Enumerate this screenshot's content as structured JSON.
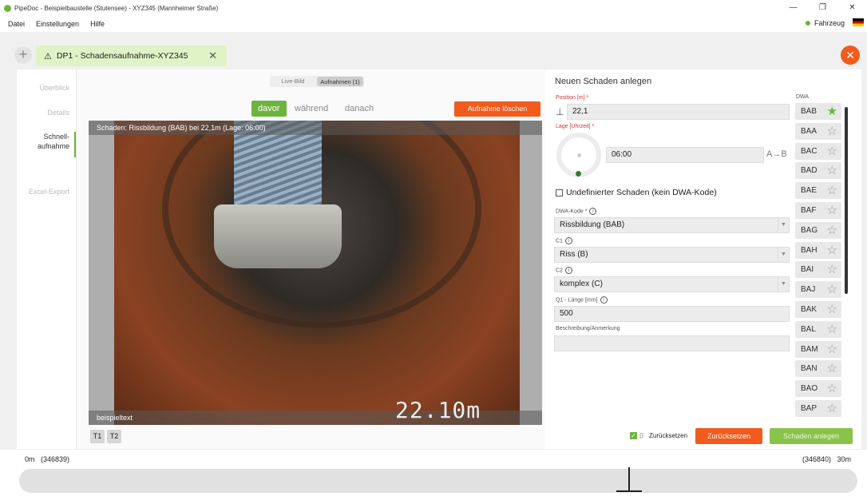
{
  "window": {
    "title": "PipeDoc - Beispielbaustelle (Stutensee) - XYZ345 (Mannheimer Straße)",
    "minimize": "—",
    "restore": "❐",
    "close": "✕"
  },
  "menu": {
    "items": [
      "Datei",
      "Einstellungen",
      "Hilfe"
    ],
    "vehicle": "Fahrzeug"
  },
  "tab": {
    "add": "+",
    "warn_icon": "⚠",
    "label": "DP1 - Schadensaufnahme-XYZ345",
    "close": "✕"
  },
  "close_circle": "✕",
  "sidenav": {
    "items": [
      "Überblick",
      "Details",
      "Schnell-\naufnahme",
      "Excel-Export"
    ]
  },
  "view_toggle": {
    "live": "Live-Bild",
    "recordings": "Aufnahmen (1)"
  },
  "phases": {
    "before": "davor",
    "during": "während",
    "after": "danach"
  },
  "delete_recording": "Aufnahme löschen",
  "video": {
    "overlay_top": "Schaden: Rissbildung (BAB) bei 22,1m (Lage: 06:00)",
    "overlay_bottom": "beispieltext",
    "meter": "22.10m"
  },
  "t_buttons": [
    "T1",
    "T2"
  ],
  "form": {
    "heading": "Neuen Schaden anlegen",
    "position_label": "Position [m] *",
    "position_value": "22,1",
    "position_icon": "⊥",
    "lage_label": "Lage [Uhrzeit] *",
    "lage_value": "06:00",
    "ab_label": "A→B",
    "undefined_label": "Undefinierter Schaden (kein DWA-Kode)",
    "dwa_label": "DWA-Kode *",
    "dwa_value": "Rissbildung (BAB)",
    "c1_label": "C1",
    "c1_value": "Riss (B)",
    "c2_label": "C2",
    "c2_value": "komplex (C)",
    "q1_label": "Q1 - Länge [mm]",
    "q1_value": "500",
    "desc_label": "Beschreibung/Anmerkung",
    "desc_value": ""
  },
  "dwa": {
    "header": "DWA",
    "items": [
      {
        "code": "BAB",
        "fav": true
      },
      {
        "code": "BAA",
        "fav": false
      },
      {
        "code": "BAC",
        "fav": false
      },
      {
        "code": "BAD",
        "fav": false
      },
      {
        "code": "BAE",
        "fav": false
      },
      {
        "code": "BAF",
        "fav": false
      },
      {
        "code": "BAG",
        "fav": false
      },
      {
        "code": "BAH",
        "fav": false
      },
      {
        "code": "BAI",
        "fav": false
      },
      {
        "code": "BAJ",
        "fav": false
      },
      {
        "code": "BAK",
        "fav": false
      },
      {
        "code": "BAL",
        "fav": false
      },
      {
        "code": "BAM",
        "fav": false
      },
      {
        "code": "BAN",
        "fav": false
      },
      {
        "code": "BAO",
        "fav": false
      },
      {
        "code": "BAP",
        "fav": false
      }
    ]
  },
  "footer": {
    "reset_checkbox": "Zurücksetzen",
    "reset_button": "Zurücksetzen",
    "create_button": "Schaden anlegen"
  },
  "ruler": {
    "left": "0m   (346839)",
    "right": "(346840)   30m"
  }
}
